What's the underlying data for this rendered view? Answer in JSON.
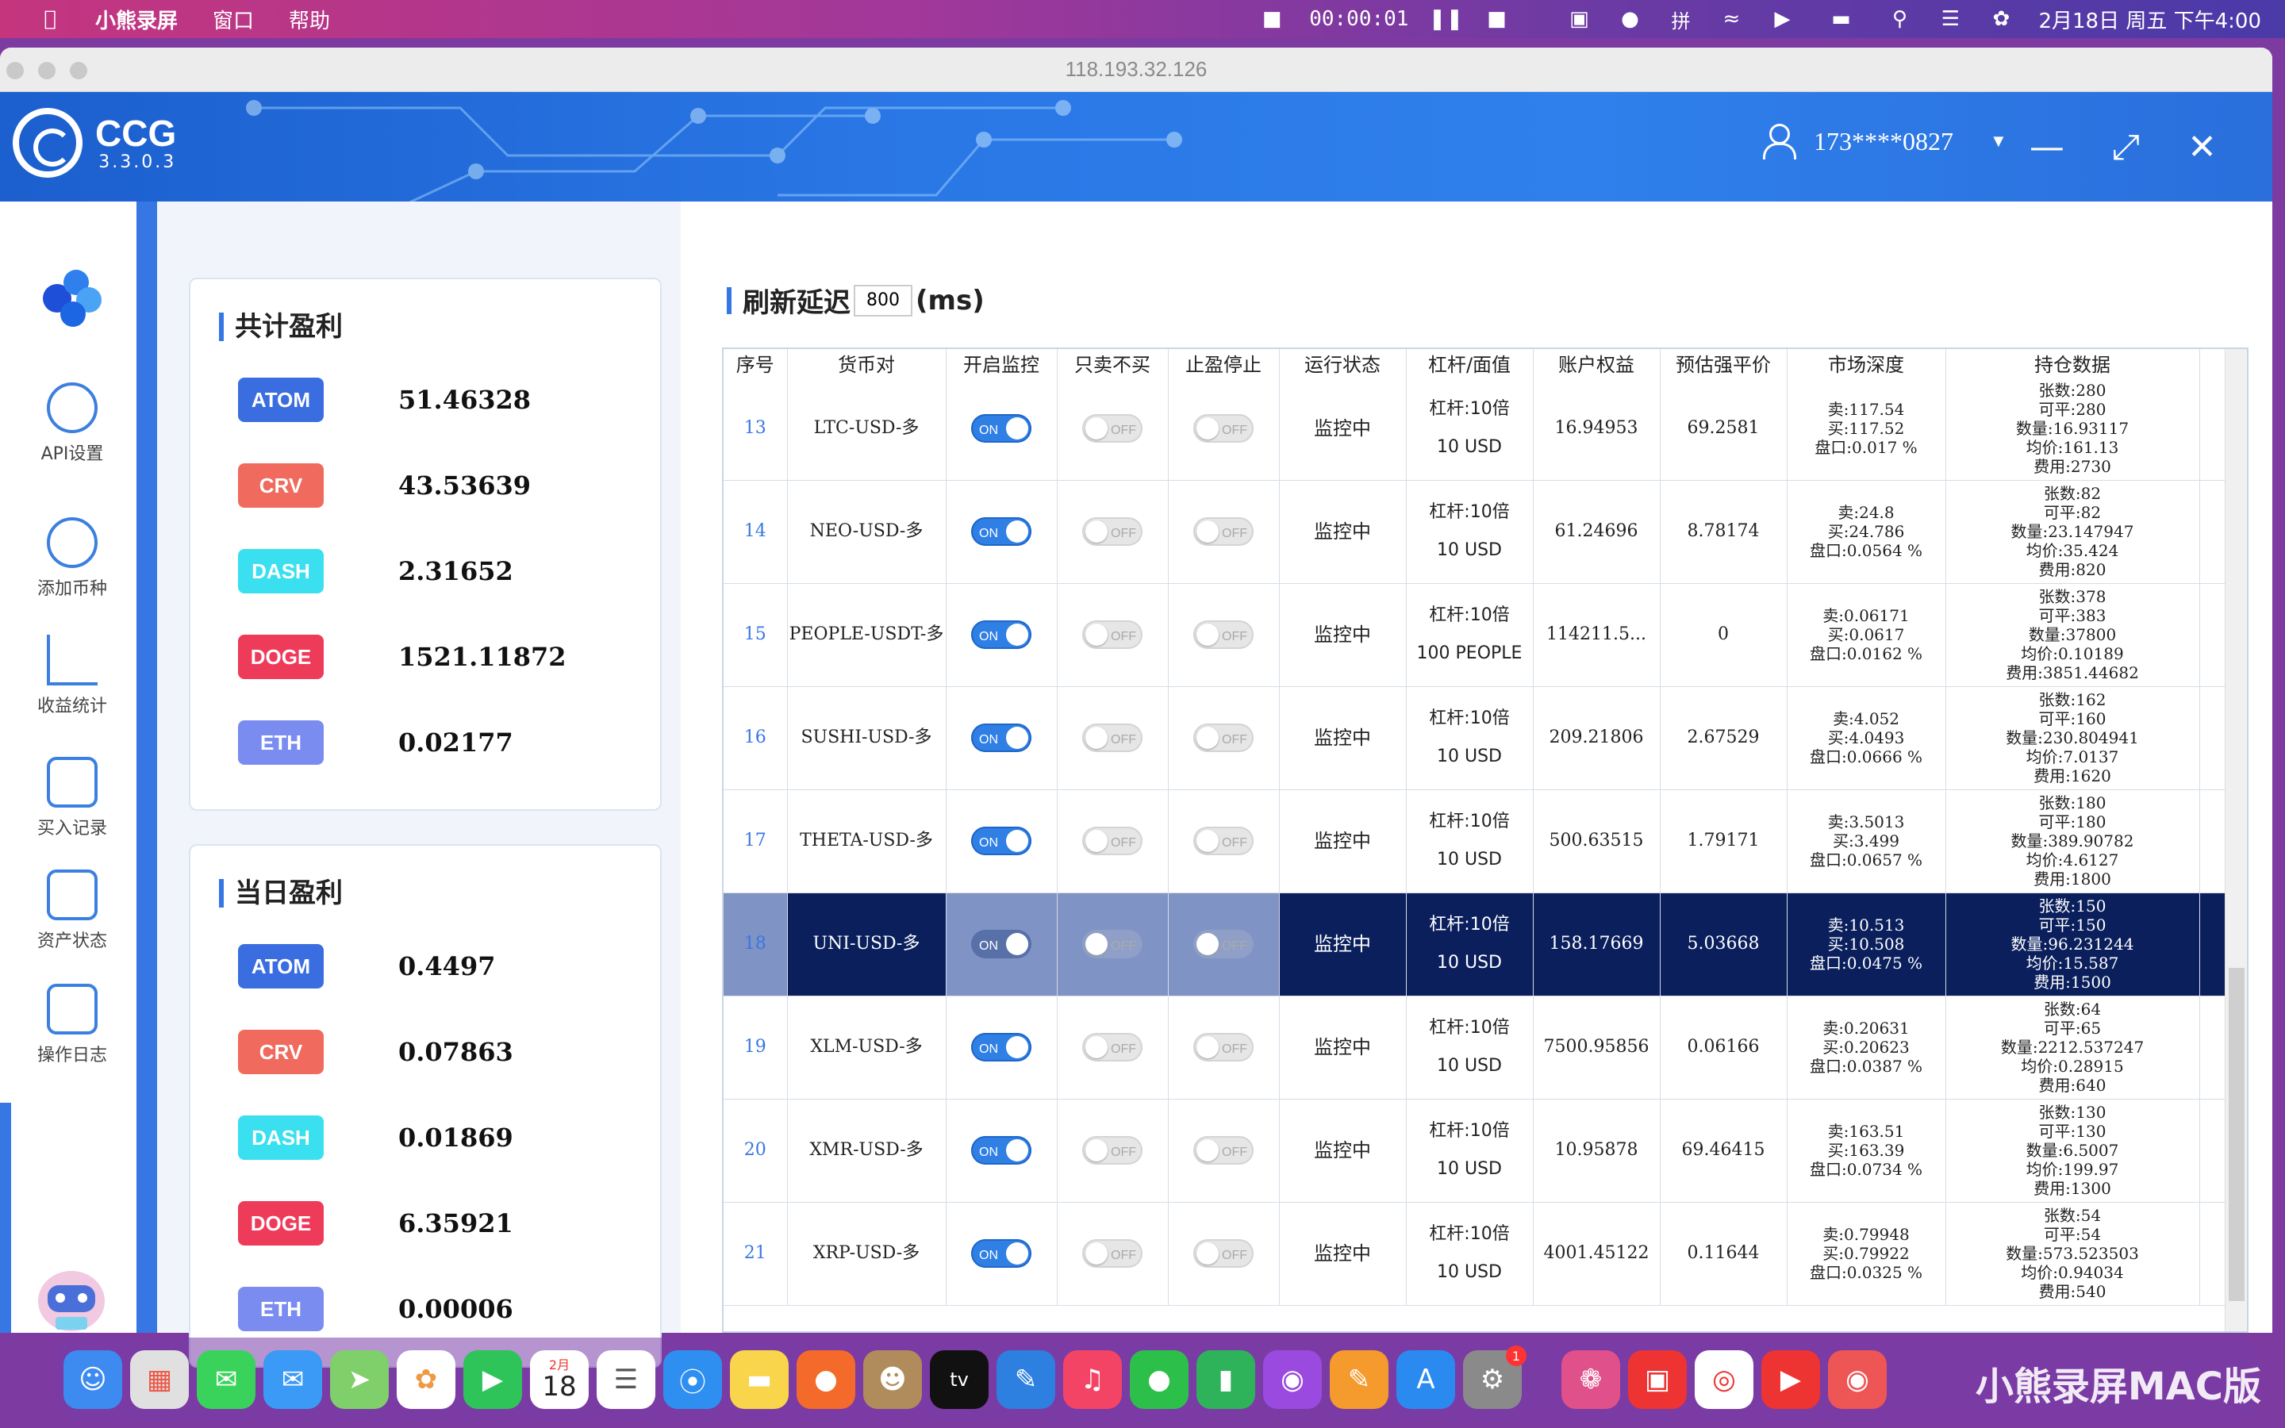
{
  "menubar": {
    "app_name": "小熊录屏",
    "items": [
      "窗口",
      "帮助"
    ],
    "record_time": "00:00:01",
    "datetime": "2月18日 周五 下午4:00",
    "ime_label": "拼"
  },
  "window": {
    "title": "118.193.32.126"
  },
  "app": {
    "brand": "CCG",
    "version": "3.3.0.3",
    "user": "173****0827"
  },
  "nav": {
    "items": [
      {
        "label": "API设置",
        "icon": "gear-icon"
      },
      {
        "label": "添加币种",
        "icon": "plus-circle-icon"
      },
      {
        "label": "收益统计",
        "icon": "chart-icon"
      },
      {
        "label": "买入记录",
        "icon": "record-icon"
      },
      {
        "label": "资产状态",
        "icon": "wallet-icon"
      },
      {
        "label": "操作日志",
        "icon": "log-icon"
      }
    ]
  },
  "total_profit": {
    "title": "共计盈利",
    "rows": [
      {
        "coin": "ATOM",
        "value": "51.46328",
        "color": "#3a6de0"
      },
      {
        "coin": "CRV",
        "value": "43.53639",
        "color": "#f06a5e"
      },
      {
        "coin": "DASH",
        "value": "2.31652",
        "color": "#3ae0f0"
      },
      {
        "coin": "DOGE",
        "value": "1521.11872",
        "color": "#ef3b5a"
      },
      {
        "coin": "ETH",
        "value": "0.02177",
        "color": "#7b8cf0"
      }
    ]
  },
  "daily_profit": {
    "title": "当日盈利",
    "rows": [
      {
        "coin": "ATOM",
        "value": "0.4497",
        "color": "#3a6de0"
      },
      {
        "coin": "CRV",
        "value": "0.07863",
        "color": "#f06a5e"
      },
      {
        "coin": "DASH",
        "value": "0.01869",
        "color": "#3ae0f0"
      },
      {
        "coin": "DOGE",
        "value": "6.35921",
        "color": "#ef3b5a"
      },
      {
        "coin": "ETH",
        "value": "0.00006",
        "color": "#7b8cf0"
      }
    ]
  },
  "refresh": {
    "label": "刷新延迟",
    "value": "800",
    "unit": "(ms)"
  },
  "table": {
    "headers": [
      "序号",
      "货币对",
      "开启监控",
      "只卖不买",
      "止盈停止",
      "运行状态",
      "杠杆/面值",
      "账户权益",
      "预估强平价",
      "市场深度",
      "持仓数据"
    ],
    "on_label": "ON",
    "off_label": "OFF",
    "rows": [
      {
        "idx": "13",
        "pair": "LTC-USD-多",
        "state": "监控中",
        "lev": "杠杆:10倍",
        "face": "10 USD",
        "equity": "16.94953",
        "liq": "69.2581",
        "depth": [
          "卖:117.54",
          "买:117.52",
          "盘口:0.017 %"
        ],
        "pos": [
          "张数:280",
          "可平:280",
          "数量:16.93117",
          "均价:161.13",
          "费用:2730"
        ]
      },
      {
        "idx": "14",
        "pair": "NEO-USD-多",
        "state": "监控中",
        "lev": "杠杆:10倍",
        "face": "10 USD",
        "equity": "61.24696",
        "liq": "8.78174",
        "depth": [
          "卖:24.8",
          "买:24.786",
          "盘口:0.0564 %"
        ],
        "pos": [
          "张数:82",
          "可平:82",
          "数量:23.147947",
          "均价:35.424",
          "费用:820"
        ]
      },
      {
        "idx": "15",
        "pair": "PEOPLE-USDT-多",
        "state": "监控中",
        "lev": "杠杆:10倍",
        "face": "100 PEOPLE",
        "equity": "114211.5...",
        "liq": "0",
        "depth": [
          "卖:0.06171",
          "买:0.0617",
          "盘口:0.0162 %"
        ],
        "pos": [
          "张数:378",
          "可平:383",
          "数量:37800",
          "均价:0.10189",
          "费用:3851.44682"
        ]
      },
      {
        "idx": "16",
        "pair": "SUSHI-USD-多",
        "state": "监控中",
        "lev": "杠杆:10倍",
        "face": "10 USD",
        "equity": "209.21806",
        "liq": "2.67529",
        "depth": [
          "卖:4.052",
          "买:4.0493",
          "盘口:0.0666 %"
        ],
        "pos": [
          "张数:162",
          "可平:160",
          "数量:230.804941",
          "均价:7.0137",
          "费用:1620"
        ]
      },
      {
        "idx": "17",
        "pair": "THETA-USD-多",
        "state": "监控中",
        "lev": "杠杆:10倍",
        "face": "10 USD",
        "equity": "500.63515",
        "liq": "1.79171",
        "depth": [
          "卖:3.5013",
          "买:3.499",
          "盘口:0.0657 %"
        ],
        "pos": [
          "张数:180",
          "可平:180",
          "数量:389.90782",
          "均价:4.6127",
          "费用:1800"
        ]
      },
      {
        "idx": "18",
        "pair": "UNI-USD-多",
        "state": "监控中",
        "lev": "杠杆:10倍",
        "face": "10 USD",
        "equity": "158.17669",
        "liq": "5.03668",
        "depth": [
          "卖:10.513",
          "买:10.508",
          "盘口:0.0475 %"
        ],
        "pos": [
          "张数:150",
          "可平:150",
          "数量:96.231244",
          "均价:15.587",
          "费用:1500"
        ],
        "selected": true
      },
      {
        "idx": "19",
        "pair": "XLM-USD-多",
        "state": "监控中",
        "lev": "杠杆:10倍",
        "face": "10 USD",
        "equity": "7500.95856",
        "liq": "0.06166",
        "depth": [
          "卖:0.20631",
          "买:0.20623",
          "盘口:0.0387 %"
        ],
        "pos": [
          "张数:64",
          "可平:65",
          "数量:2212.537247",
          "均价:0.28915",
          "费用:640"
        ]
      },
      {
        "idx": "20",
        "pair": "XMR-USD-多",
        "state": "监控中",
        "lev": "杠杆:10倍",
        "face": "10 USD",
        "equity": "10.95878",
        "liq": "69.46415",
        "depth": [
          "卖:163.51",
          "买:163.39",
          "盘口:0.0734 %"
        ],
        "pos": [
          "张数:130",
          "可平:130",
          "数量:6.5007",
          "均价:199.97",
          "费用:1300"
        ]
      },
      {
        "idx": "21",
        "pair": "XRP-USD-多",
        "state": "监控中",
        "lev": "杠杆:10倍",
        "face": "10 USD",
        "equity": "4001.45122",
        "liq": "0.11644",
        "depth": [
          "卖:0.79948",
          "买:0.79922",
          "盘口:0.0325 %"
        ],
        "pos": [
          "张数:54",
          "可平:54",
          "数量:573.523503",
          "均价:0.94034",
          "费用:540"
        ]
      }
    ]
  },
  "dock": {
    "calendar_month": "2月",
    "calendar_day": "18",
    "settings_badge": "1",
    "appletv_label": "tv"
  },
  "watermark": "小熊录屏MAC版"
}
